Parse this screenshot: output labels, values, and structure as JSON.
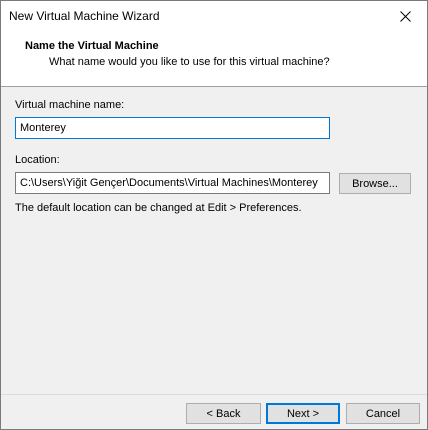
{
  "window": {
    "title": "New Virtual Machine Wizard"
  },
  "header": {
    "title": "Name the Virtual Machine",
    "subtitle": "What name would you like to use for this virtual machine?"
  },
  "name_field": {
    "label": "Virtual machine name:",
    "value": "Monterey"
  },
  "location_field": {
    "label": "Location:",
    "value": "C:\\Users\\Yiğit Gençer\\Documents\\Virtual Machines\\Monterey",
    "browse_label": "Browse..."
  },
  "hint": "The default location can be changed at Edit > Preferences.",
  "footer": {
    "back_label": "< Back",
    "next_label": "Next >",
    "cancel_label": "Cancel"
  },
  "colors": {
    "focus_accent": "#0078d7",
    "header_bg": "#ffffff",
    "dialog_bg": "#f0f0f0"
  }
}
